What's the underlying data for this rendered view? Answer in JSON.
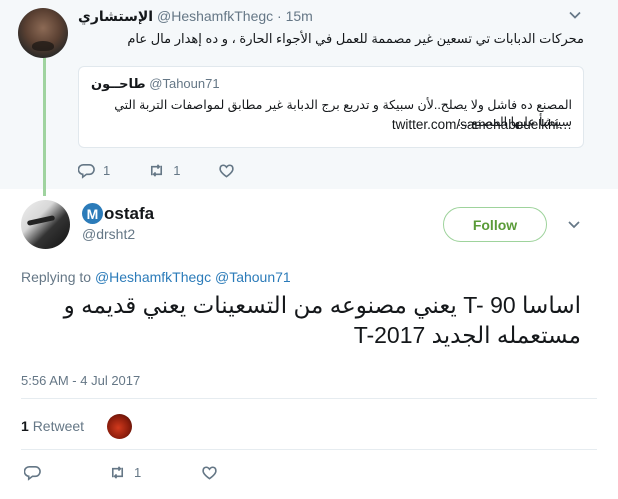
{
  "parent_tweet": {
    "name": "الإستشاري",
    "handle": "@HeshamfkThegc",
    "separator": "·",
    "time": "15m",
    "text": "محركات الدبابات تي تسعين غير مصممة للعمل في الأجواء الحارة ، و ده إهدار مال عام",
    "quoted": {
      "name": "طاحــون",
      "handle": "@Tahoun71",
      "text": "المصنع ده فاشل ولا يصلح..لأن سبيكة و تدريع برج الدبابة غير مطابق لمواصفات التربة التي سينشأ عليها المصنع....",
      "link": "twitter.com/samehabouelkhi…"
    },
    "actions": {
      "reply_count": "1",
      "retweet_count": "1",
      "like_count": ""
    }
  },
  "main_tweet": {
    "name_initial": "M",
    "name_rest": "ostafa",
    "handle": "@drsht2",
    "follow_label": "Follow",
    "replying_prefix": "Replying to",
    "replying_to": [
      "@HeshamfkThegc",
      "@Tahoun71"
    ],
    "text": "اساسا T- 90 يعني مصنوعه من التسعينات يعني قديمه و مستعمله الجديد T-2017",
    "timestamp": "5:56 AM - 4 Jul 2017",
    "retweets_count": "1",
    "retweets_label": "Retweet",
    "actions": {
      "reply_count": "",
      "retweet_count": "1",
      "like_count": ""
    }
  },
  "colors": {
    "link": "#2b7bb9",
    "follow_border": "#9ed39c",
    "follow_text": "#5a9b38",
    "thread_line": "#9fd39f",
    "muted": "#657786",
    "parent_bg": "#f5f8fa"
  }
}
